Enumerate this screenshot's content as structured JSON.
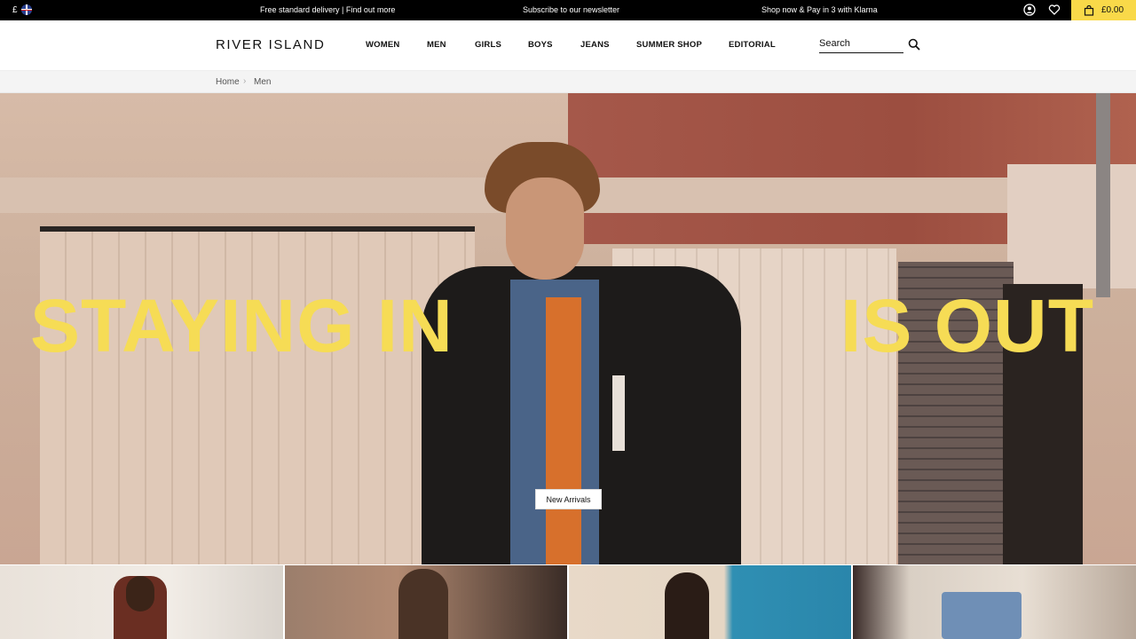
{
  "topbar": {
    "currency_symbol": "£",
    "promos": [
      "Free standard delivery | Find out more",
      "Subscribe to our newsletter",
      "Shop now & Pay in 3 with Klarna"
    ],
    "bag_total": "£0.00",
    "bag_color": "#f9d949"
  },
  "header": {
    "logo": "RIVER ISLAND",
    "nav": [
      "WOMEN",
      "MEN",
      "GIRLS",
      "BOYS",
      "JEANS",
      "SUMMER SHOP",
      "EDITORIAL"
    ],
    "search_placeholder": "Search"
  },
  "breadcrumb": [
    "Home",
    "Men"
  ],
  "hero": {
    "headline_left": "STAYING IN",
    "headline_right": "IS OUT",
    "headline_color": "#f6dc55",
    "cta_label": "New Arrivals"
  }
}
